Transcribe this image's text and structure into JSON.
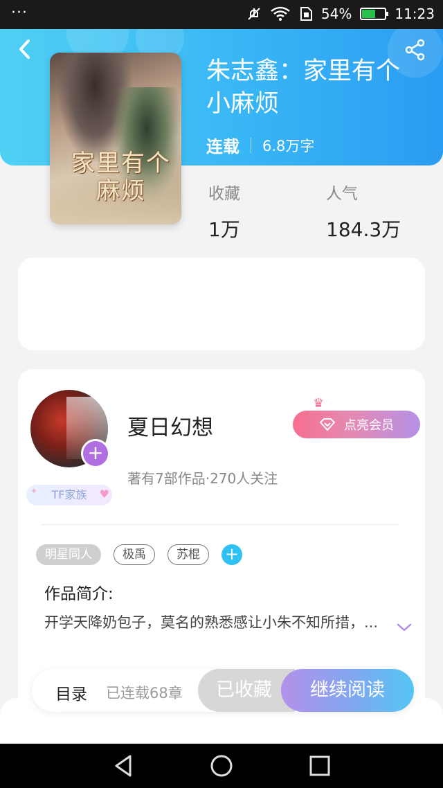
{
  "status_bar": {
    "dots": "···",
    "battery": "54%",
    "battery_level": 0.54,
    "time": "11:23",
    "icons": [
      "mute-icon",
      "wifi-icon",
      "sim-icon",
      "battery-icon"
    ]
  },
  "header": {
    "back_icon": "chevron-left-icon",
    "share_icon": "share-icon",
    "colors": {
      "gradient_start": "#4fd0f3",
      "gradient_end": "#2a9cf2"
    }
  },
  "book": {
    "cover_text": "家里有个麻烦",
    "title": "朱志鑫：家里有个小麻烦",
    "status": "连载",
    "word_count": "6.8万字",
    "stats": [
      {
        "label": "收藏",
        "value": "1万"
      },
      {
        "label": "人气",
        "value": "184.3万"
      }
    ]
  },
  "author": {
    "name": "夏日幻想",
    "info": "著有7部作品·270人关注",
    "family_badge": "TF家族",
    "vip_button": "点亮会员",
    "follow_icon": "plus-icon"
  },
  "tags": [
    "明星同人",
    "极禹",
    "苏棍"
  ],
  "intro": {
    "title": "作品简介:",
    "text": "开学天降奶包子，莫名的熟悉感让小朱不知所措，..."
  },
  "action_bar": {
    "toc": "目录",
    "chapters": "已连载68章",
    "collected": "已收藏",
    "read": "继续阅读"
  },
  "nav": {
    "icons": [
      "back-triangle-icon",
      "home-circle-icon",
      "recents-square-icon"
    ]
  }
}
